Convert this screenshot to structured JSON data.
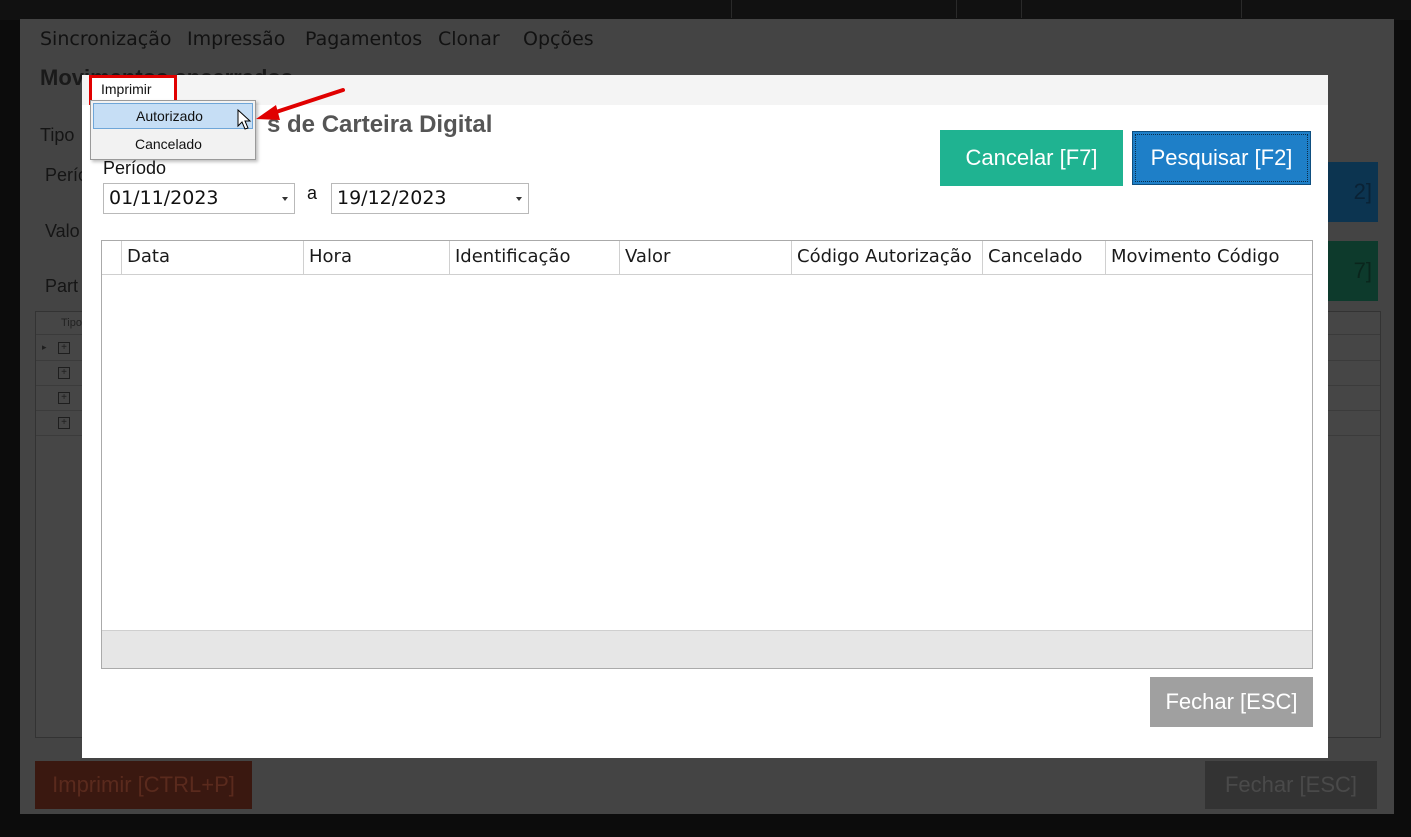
{
  "background": {
    "menu": [
      "Sincronização",
      "Impressão",
      "Pagamentos",
      "Clonar",
      "Opções"
    ],
    "title": "Movimentos encerrados",
    "labels": [
      "Tipo",
      "Perío",
      "Valo",
      "Part"
    ],
    "search_button_fragment": "2]",
    "cancel_button_fragment": "7]",
    "grid_header_fragment": "Tipo",
    "print_button": "Imprimir [CTRL+P]",
    "close_button": "Fechar [ESC]"
  },
  "modal": {
    "title": "s de Carteira Digital",
    "cancel_button": "Cancelar [F7]",
    "search_button": "Pesquisar [F2]",
    "periodo_label": "Período",
    "date_from": "01/11/2023",
    "date_separator": "a",
    "date_to": "19/12/2023",
    "columns": [
      "Data",
      "Hora",
      "Identificação",
      "Valor",
      "Código Autorização",
      "Cancelado",
      "Movimento Código"
    ],
    "close_button": "Fechar [ESC]"
  },
  "context_menu": {
    "title": "Imprimir",
    "items": [
      "Autorizado",
      "Cancelado"
    ],
    "highlighted": "Autorizado"
  },
  "colors": {
    "cancel": "#1fb391",
    "search": "#1e7fc8",
    "close": "#a0a0a0",
    "highlight": "#e00000"
  }
}
